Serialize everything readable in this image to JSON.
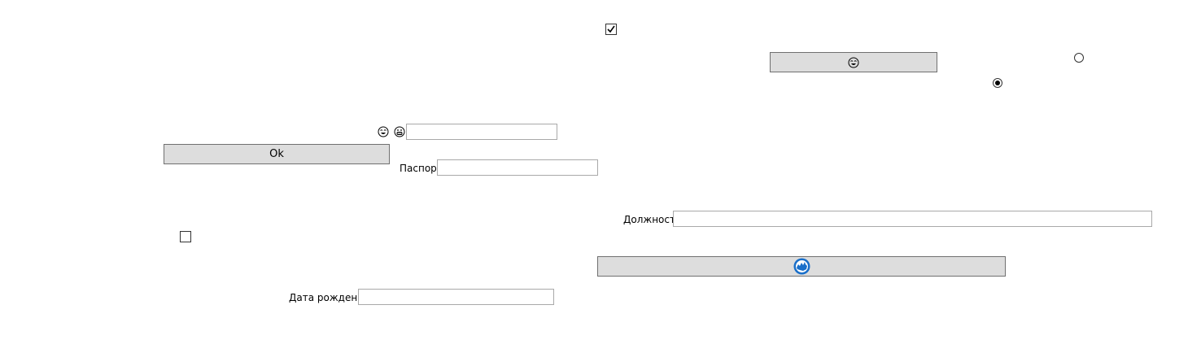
{
  "buttons": {
    "ok_label": "Ok"
  },
  "labels": {
    "passport": "Паспорт",
    "position": "Должность",
    "birth_date": "Дата рождения"
  },
  "inputs": {
    "top_value": "",
    "passport_value": "",
    "position_value": "",
    "birth_date_value": ""
  },
  "checkboxes": {
    "top_checked": true,
    "left_checked": false
  },
  "radios": {
    "radio_1_selected": false,
    "radio_2_selected": true
  },
  "icons": {
    "emoji_1": "laughing-face-icon",
    "emoji_2": "grinning-face-icon",
    "button_emoji": "laughing-face-icon",
    "button_globe": "globe-icon"
  },
  "colors": {
    "button_bg": "#dddddd",
    "globe_blue": "#1a6fc9"
  }
}
